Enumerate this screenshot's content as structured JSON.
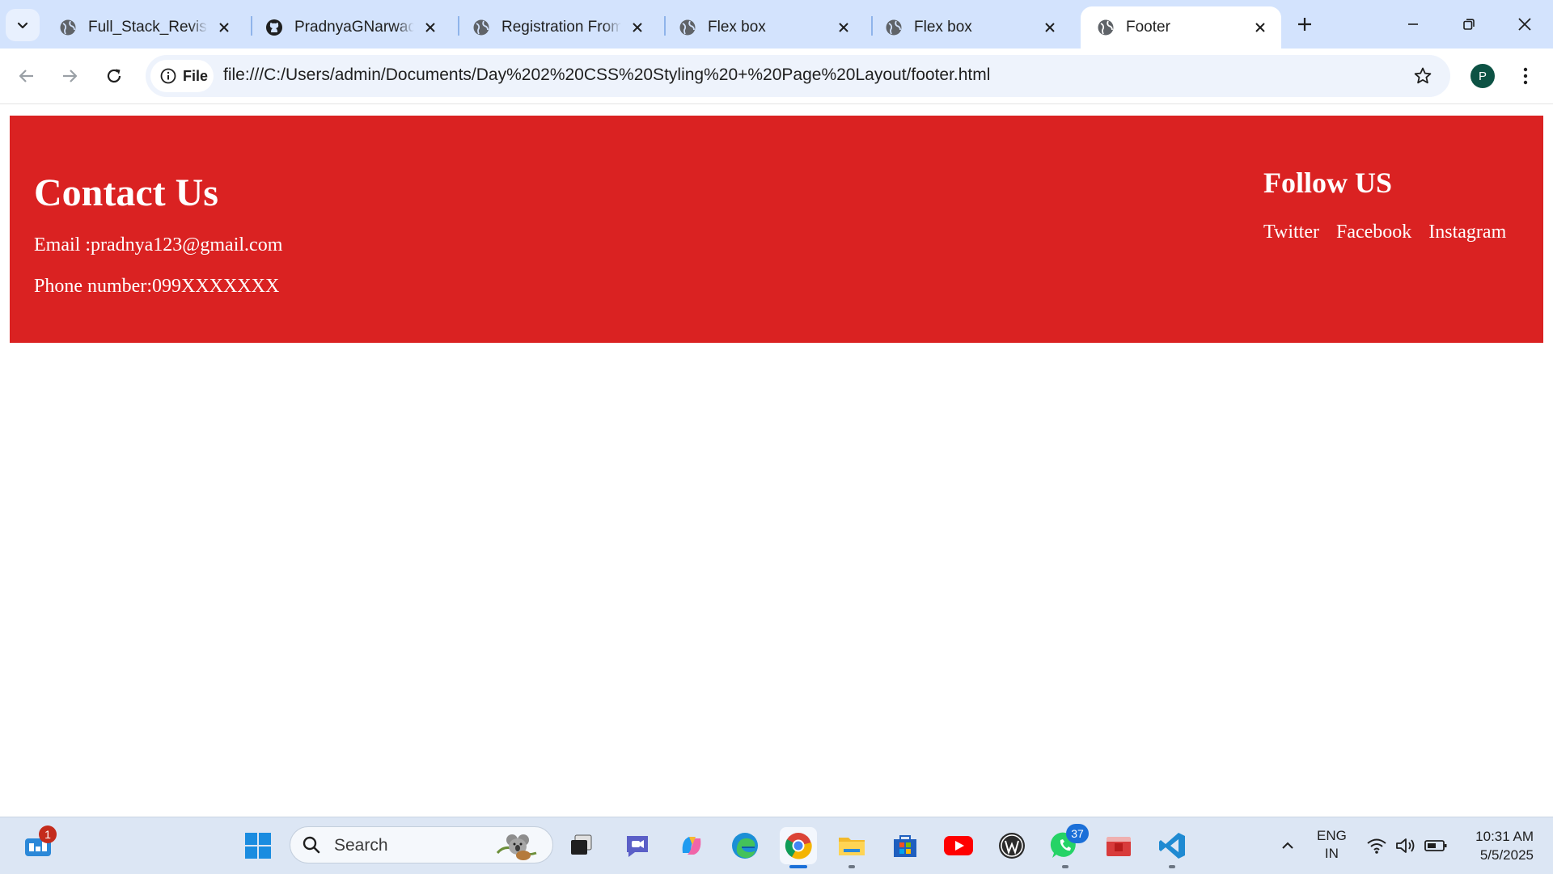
{
  "tabs": [
    {
      "title": "Full_Stack_Revision",
      "icon": "globe-icon"
    },
    {
      "title": "PradnyaGNarwade",
      "icon": "github-icon"
    },
    {
      "title": "Registration From",
      "icon": "globe-icon"
    },
    {
      "title": "Flex box",
      "icon": "globe-icon"
    },
    {
      "title": "Flex box",
      "icon": "globe-icon"
    },
    {
      "title": "Footer",
      "icon": "globe-icon",
      "active": true
    }
  ],
  "toolbar": {
    "site_chip_label": "File",
    "url": "file:///C:/Users/admin/Documents/Day%202%20CSS%20Styling%20+%20Page%20Layout/footer.html",
    "profile_initial": "P"
  },
  "page": {
    "contact": {
      "heading": "Contact Us",
      "email": "Email :pradnya123@gmail.com",
      "phone": "Phone number:099XXXXXXX"
    },
    "follow": {
      "heading": "Follow US",
      "links": [
        "Twitter",
        "Facebook",
        "Instagram"
      ]
    },
    "footer_color": "#da2222"
  },
  "taskbar": {
    "widgets_badge": "1",
    "search_placeholder": "Search",
    "whatsapp_badge": "37",
    "language_line1": "ENG",
    "language_line2": "IN",
    "time": "10:31 AM",
    "date": "5/5/2025"
  },
  "colors": {
    "tab_strip": "#d3e3fd",
    "accent": "#1a6fd8",
    "footer": "#da2222"
  }
}
